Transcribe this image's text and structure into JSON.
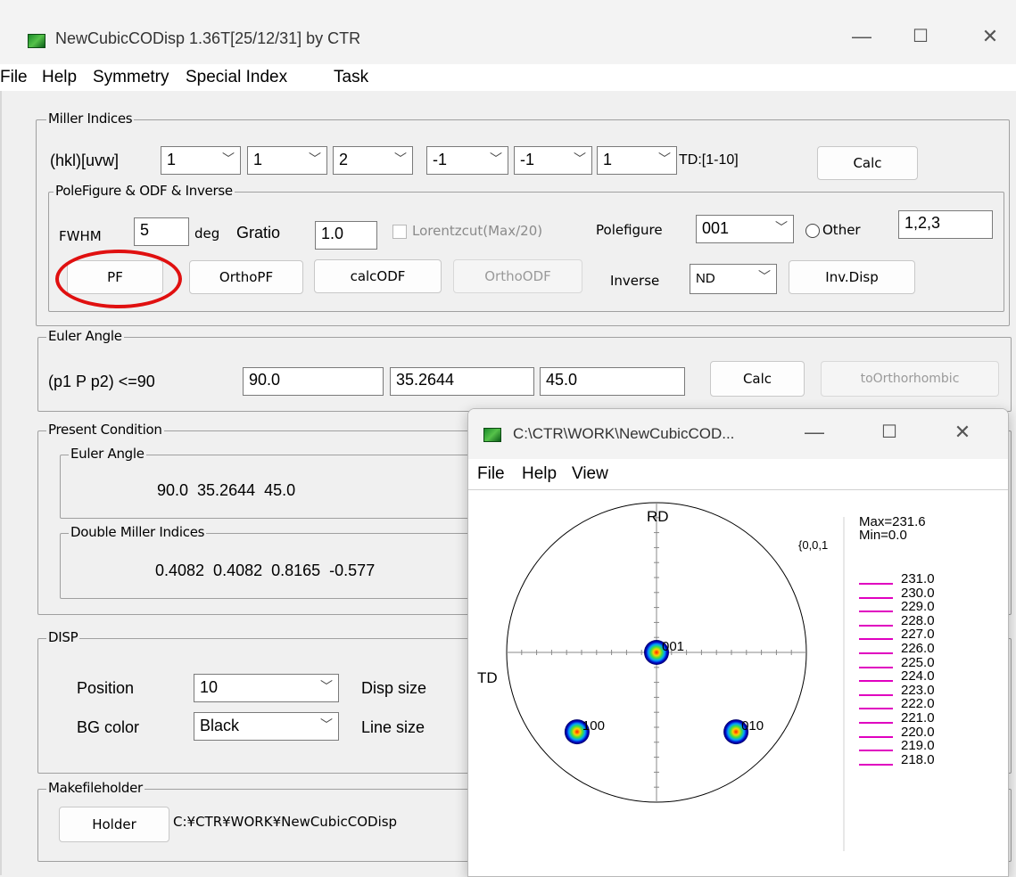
{
  "window": {
    "title": "NewCubicCODisp 1.36T[25/12/31] by CTR",
    "minimize": "—",
    "maximize": "☐",
    "close": "✕"
  },
  "menu": [
    "File",
    "Help",
    "Symmetry",
    "Special Index",
    "Task"
  ],
  "miller": {
    "group_label": "Miller Indices",
    "hkl_label": "(hkl)[uvw]",
    "values": [
      "1",
      "1",
      "2",
      "-1",
      "-1",
      "1"
    ],
    "td_label": "TD:[1-10]",
    "calc_label": "Calc"
  },
  "pole": {
    "group_label": "PoleFigure & ODF & Inverse",
    "fwhm_label": "FWHM",
    "fwhm_value": "5",
    "deg_label": "deg",
    "gratio_label": "Gratio",
    "gratio_value": "1.0",
    "lorentz_label": "Lorentzcut(Max/20)",
    "polefigure_label": "Polefigure",
    "polefigure_value": "001",
    "other_label": "Other",
    "other_value": "1,2,3",
    "pf_label": "PF",
    "orthopf_label": "OrthoPF",
    "calcodf_label": "calcODF",
    "orthoodf_label": "OrthoODF",
    "inverse_label": "Inverse",
    "inverse_value": "ND",
    "invdisp_label": "Inv.Disp"
  },
  "euler": {
    "group_label": "Euler Angle",
    "range_label": "(p1 P p2) <=90",
    "values": [
      "90.0",
      "35.2644",
      "45.0"
    ],
    "calc_label": "Calc",
    "ortho_label": "toOrthorhombic"
  },
  "present": {
    "group_label": "Present Condition",
    "euler_label": "Euler Angle",
    "euler_text": "90.0  35.2644  45.0",
    "dmi_label": "Double Miller Indices",
    "dmi_text": "0.4082  0.4082  0.8165  -0.577"
  },
  "disp": {
    "group_label": "DISP",
    "position_label": "Position",
    "position_value": "10",
    "dispsize_label": "Disp size",
    "bgcolor_label": "BG color",
    "bgcolor_value": "Black",
    "linesize_label": "Line size"
  },
  "makefile": {
    "group_label": "Makefileholder",
    "holder_label": "Holder",
    "path": "C:¥CTR¥WORK¥NewCubicCODisp"
  },
  "child": {
    "title": "C:\\CTR\\WORK\\NewCubicCOD...",
    "minimize": "—",
    "maximize": "☐",
    "close": "✕",
    "menu": [
      "File",
      "Help",
      "View"
    ],
    "rd_label": "RD",
    "td_label": "TD",
    "pole_label": "{0,0,1",
    "max_text": "Max=231.6",
    "min_text": "Min=0.0",
    "poles": [
      {
        "label": "001",
        "r": 0.0,
        "theta_deg": 0
      },
      {
        "label": "100",
        "r": 0.75,
        "theta_deg": 225
      },
      {
        "label": "010",
        "r": 0.75,
        "theta_deg": 315
      }
    ],
    "legend": [
      "231.0",
      "230.0",
      "229.0",
      "228.0",
      "227.0",
      "226.0",
      "225.0",
      "224.0",
      "223.0",
      "222.0",
      "221.0",
      "220.0",
      "219.0",
      "218.0"
    ],
    "legend_color": "#e000c0"
  },
  "colors": {
    "highlight_ring": "#e01010"
  }
}
